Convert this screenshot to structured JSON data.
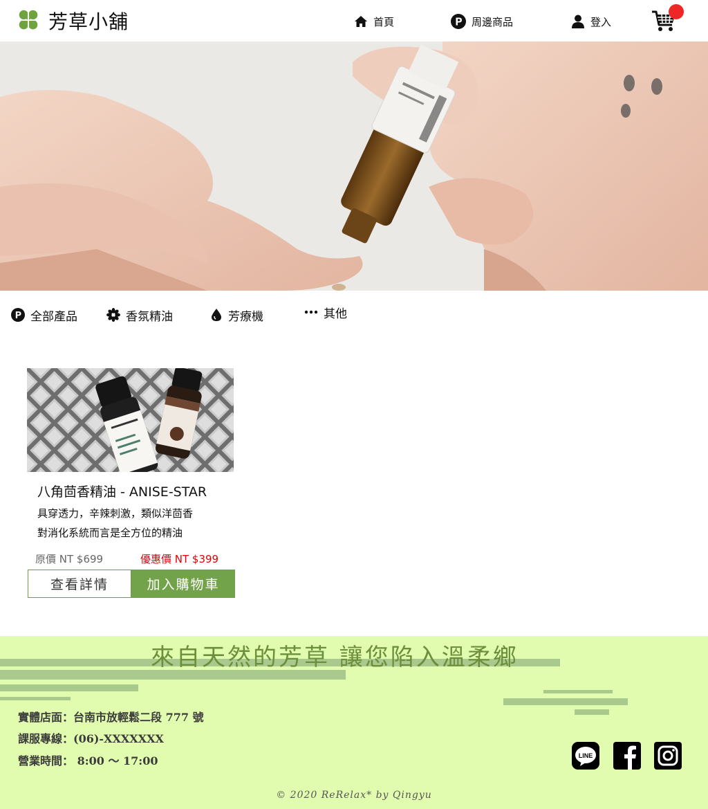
{
  "header": {
    "logo_text": "芳草小舖",
    "nav": {
      "home": "首頁",
      "merch": "周邊商品",
      "login": "登入"
    },
    "cart_icon": "cart-icon"
  },
  "categories": {
    "all": "全部產品",
    "essential_oil": "香氛精油",
    "diffuser": "芳療機",
    "other": "其他"
  },
  "product": {
    "title": "八角茴香精油 - ANISE-STAR",
    "desc_line1": "具穿透力，辛辣刺激，類似洋茴香",
    "desc_line2": "對消化系統而言是全方位的精油",
    "original_price": "原價 NT $699",
    "sale_price": "優惠價 NT $399",
    "detail_button": "查看詳情",
    "add_cart_button": "加入購物車"
  },
  "footer": {
    "slogan": "來自天然的芳草 讓您陷入溫柔鄉",
    "store_address": "實體店面：台南市放輕鬆二段 777 號",
    "service_phone": "課服專線：(06)-XXXXXXX",
    "business_hours": "營業時間： 8:00 ～ 17:00",
    "copyright": "© 2020 ReRelax* by Qingyu"
  },
  "colors": {
    "accent_green": "#72a24a",
    "footer_bg": "#e1fcaf",
    "sale_red": "#e60000",
    "cart_badge": "#ef2626"
  }
}
